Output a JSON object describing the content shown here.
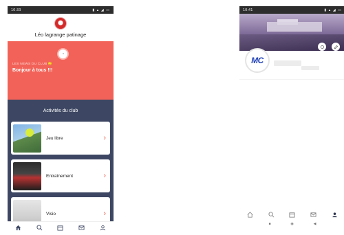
{
  "left": {
    "status_time": "10:33",
    "status_icons": "▮ ▴ ◢ ▭",
    "club_name": "Léo lagrange patinage",
    "news_tag": "LES NEWS DU CLUB 🙂",
    "news_text": "Bonjour à tous !!!",
    "activities_title": "Activités du club",
    "activities": [
      {
        "label": "Jeu libre"
      },
      {
        "label": "Entraînement"
      },
      {
        "label": "Visio"
      }
    ],
    "nav": [
      "home-icon",
      "search-icon",
      "calendar-icon",
      "mail-icon",
      "profile-icon"
    ]
  },
  "right": {
    "status_time": "10:41",
    "status_icons": "▮ ▴ ◢ ▭",
    "avatar_text": "MC",
    "nav": [
      "home-icon",
      "search-icon",
      "calendar-icon",
      "mail-icon",
      "profile-icon"
    ],
    "system_nav": [
      "■",
      "◉",
      "◀"
    ]
  },
  "colors": {
    "accent": "#f26258",
    "activities_bg": "#3d4763",
    "brand_blue": "#1d3fb8"
  }
}
